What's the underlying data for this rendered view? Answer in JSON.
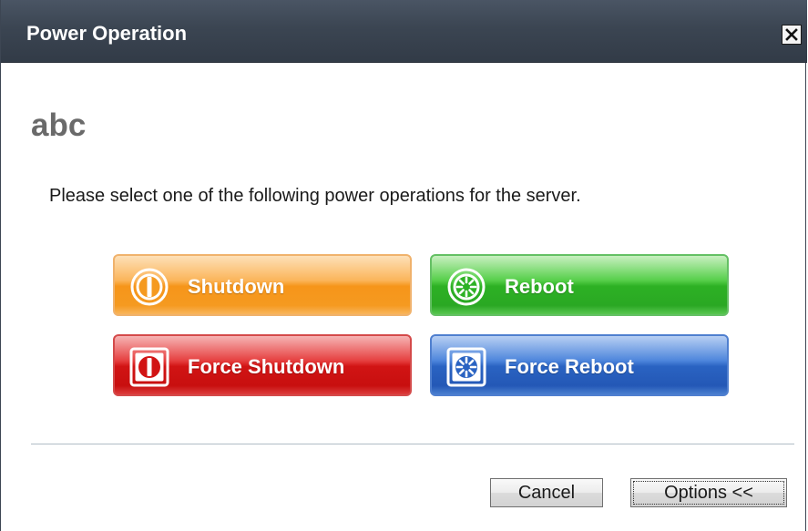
{
  "dialog": {
    "title": "Power Operation",
    "close_icon": "close-icon"
  },
  "heading": "abc",
  "instruction": "Please select one of the following power operations for the server.",
  "operations": [
    {
      "label": "Shutdown",
      "icon": "power-icon",
      "color": "#f6951a"
    },
    {
      "label": "Reboot",
      "icon": "reboot-icon",
      "color": "#2db124"
    },
    {
      "label": "Force Shutdown",
      "icon": "force-power-icon",
      "color": "#d11414"
    },
    {
      "label": "Force Reboot",
      "icon": "force-reboot-icon",
      "color": "#2a63c2"
    }
  ],
  "footer": {
    "cancel_label": "Cancel",
    "options_label": "Options <<"
  }
}
